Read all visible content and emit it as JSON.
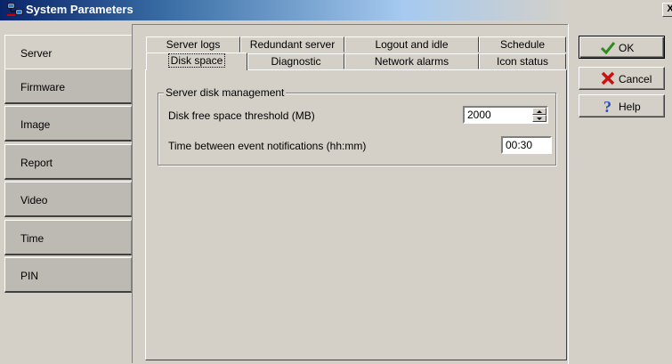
{
  "window": {
    "title": "System Parameters",
    "close_glyph": "X",
    "icon": "system-parameters-icon"
  },
  "sidebar": {
    "items": [
      {
        "label": "Server",
        "active": true
      },
      {
        "label": "Firmware",
        "active": false
      },
      {
        "label": "Image",
        "active": false
      },
      {
        "label": "Report",
        "active": false
      },
      {
        "label": "Video",
        "active": false
      },
      {
        "label": "Time",
        "active": false
      },
      {
        "label": "PIN",
        "active": false
      }
    ]
  },
  "tabs": {
    "row1": [
      "Server logs",
      "Redundant server",
      "Logout and idle",
      "Schedule"
    ],
    "row2": [
      "Disk space",
      "Diagnostic",
      "Network alarms",
      "Icon status"
    ],
    "active": "Disk space"
  },
  "disk_space": {
    "group_title": "Server disk management",
    "threshold_label": "Disk free space threshold (MB)",
    "threshold_value": "2000",
    "notify_label": "Time between event notifications (hh:mm)",
    "notify_value": "00:30"
  },
  "buttons": {
    "ok": {
      "label": "OK",
      "icon": "checkmark-icon",
      "color": "#2e8b1e"
    },
    "cancel": {
      "label": "Cancel",
      "icon": "x-icon",
      "color": "#cc1010"
    },
    "help": {
      "label": "Help",
      "icon": "question-icon",
      "color": "#1f4fbf"
    }
  }
}
